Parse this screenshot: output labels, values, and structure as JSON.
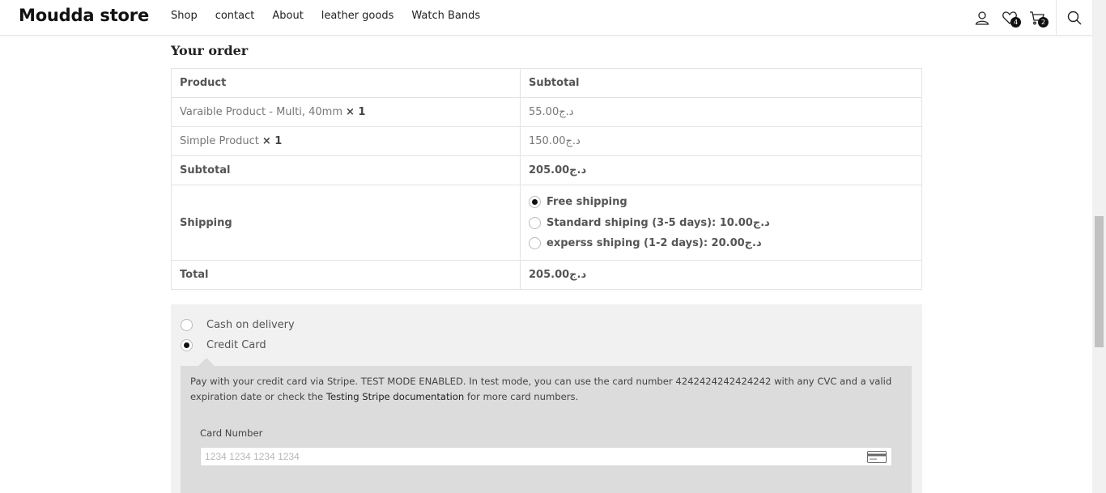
{
  "header": {
    "logo": "Moudda store",
    "nav": [
      "Shop",
      "contact",
      "About",
      "leather goods",
      "Watch Bands"
    ],
    "wishlist_count": "4",
    "cart_count": "2",
    "icons": [
      "user-icon",
      "heart-icon",
      "cart-icon",
      "search-icon"
    ]
  },
  "order": {
    "title": "Your order",
    "headers": {
      "product": "Product",
      "subtotal": "Subtotal"
    },
    "items": [
      {
        "name": "Varaible Product - Multi, 40mm",
        "qty": "× 1",
        "price": "55.00د.ج"
      },
      {
        "name": "Simple Product",
        "qty": "× 1",
        "price": "150.00د.ج"
      }
    ],
    "subtotal_label": "Subtotal",
    "subtotal_value": "205.00د.ج",
    "shipping_label": "Shipping",
    "shipping_options": [
      {
        "label": "Free shipping",
        "selected": true
      },
      {
        "label": "Standard shiping (3-5 days): 10.00د.ج",
        "selected": false
      },
      {
        "label": "experss shiping (1-2 days): 20.00د.ج",
        "selected": false
      }
    ],
    "total_label": "Total",
    "total_value": "205.00د.ج"
  },
  "payment": {
    "methods": [
      {
        "label": "Cash on delivery",
        "selected": false
      },
      {
        "label": "Credit Card",
        "selected": true
      }
    ],
    "description_before": "Pay with your credit card via Stripe. TEST MODE ENABLED. In test mode, you can use the card number 4242424242424242 with any CVC and a valid expiration date or check the ",
    "description_link": "Testing Stripe documentation",
    "description_after": " for more card numbers.",
    "card_number_label": "Card Number",
    "card_number_placeholder": "1234 1234 1234 1234"
  }
}
